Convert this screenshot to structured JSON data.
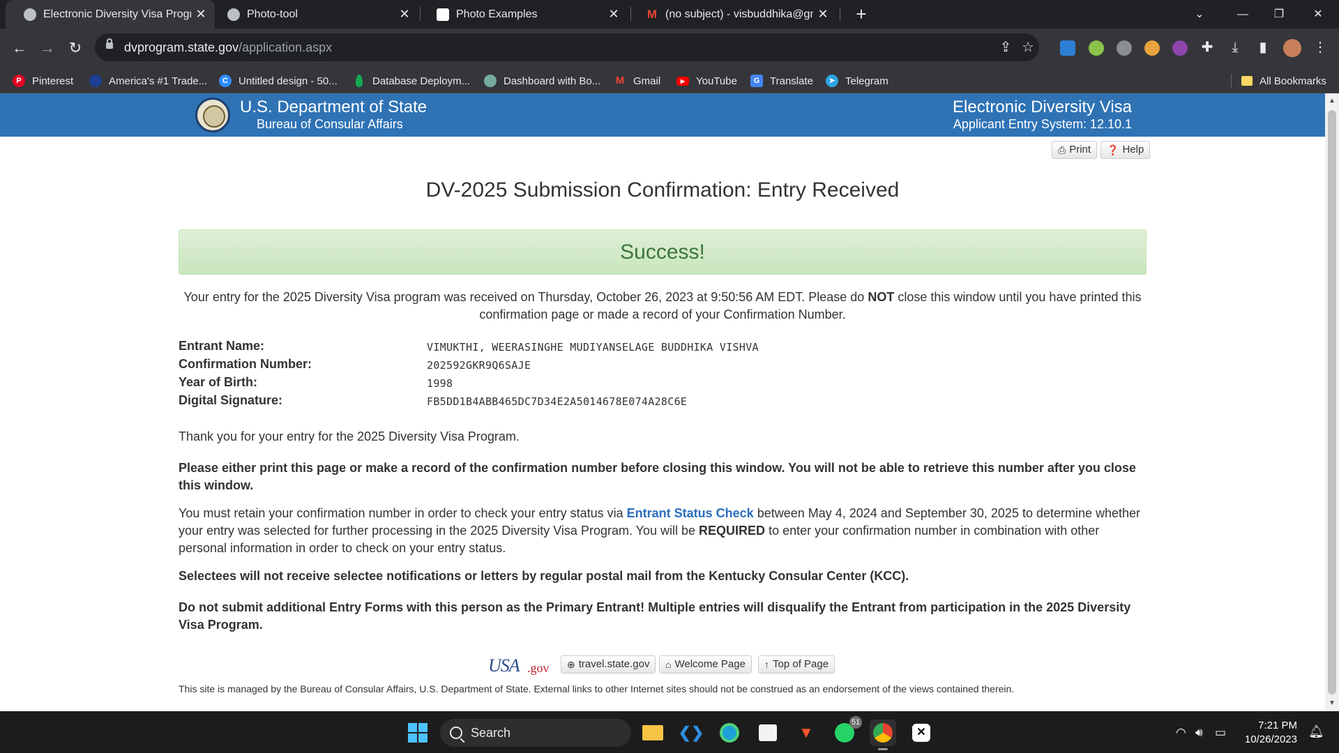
{
  "browser": {
    "tabs": [
      {
        "title": "Electronic Diversity Visa Program",
        "active": true
      },
      {
        "title": "Photo-tool",
        "active": false
      },
      {
        "title": "Photo Examples",
        "active": false
      },
      {
        "title": "(no subject) - visbuddhika@gmail.com",
        "active": false
      }
    ],
    "new_tab_label": "+",
    "url_host": "dvprogram.state.gov",
    "url_path": "/application.aspx",
    "bookmarks": [
      {
        "label": "Pinterest",
        "icon": "pinterest-icon",
        "color": "#e60023"
      },
      {
        "label": "America's #1 Trade...",
        "icon": "trade-icon",
        "color": "#1c3f94"
      },
      {
        "label": "Untitled design - 50...",
        "icon": "canva-icon",
        "color": "#2d8cff"
      },
      {
        "label": "Database Deploym...",
        "icon": "mongodb-icon",
        "color": "#13aa52"
      },
      {
        "label": "Dashboard with Bo...",
        "icon": "chatgpt-icon",
        "color": "#74aa9c"
      },
      {
        "label": "Gmail",
        "icon": "gmail-icon",
        "color": "#ea4335"
      },
      {
        "label": "YouTube",
        "icon": "youtube-icon",
        "color": "#ff0000"
      },
      {
        "label": "Translate",
        "icon": "translate-icon",
        "color": "#4285f4"
      },
      {
        "label": "Telegram",
        "icon": "telegram-icon",
        "color": "#2aa3e0"
      }
    ],
    "all_bookmarks_label": "All Bookmarks"
  },
  "site": {
    "dept": "U.S. Department of State",
    "bureau": "Bureau of Consular Affairs",
    "system_title": "Electronic Diversity Visa",
    "system_version": "Applicant Entry System: 12.10.1",
    "print_label": "Print",
    "help_label": "Help",
    "header_color": "#2f73b5"
  },
  "confirmation": {
    "title": "DV-2025 Submission Confirmation: Entry Received",
    "success": "Success!",
    "received_pre": "Your entry for the 2025 Diversity Visa program was received on Thursday, October 26, 2023 at 9:50:56 AM EDT. Please do ",
    "received_not": "NOT",
    "received_post": " close this window until you have printed this confirmation page or made a record of your Confirmation Number.",
    "details": [
      {
        "label": "Entrant Name:",
        "value": "VIMUKTHI, WEERASINGHE MUDIYANSELAGE BUDDHIKA VISHVA"
      },
      {
        "label": "Confirmation Number:",
        "value": "202592GKR9Q6SAJE"
      },
      {
        "label": "Year of Birth:",
        "value": "1998"
      },
      {
        "label": "Digital Signature:",
        "value": "FB5DD1B4ABB465DC7D34E2A5014678E074A28C6E"
      }
    ],
    "thanks": "Thank you for your entry for the 2025 Diversity Visa Program.",
    "print_warning": "Please either print this page or make a record of the confirmation number before closing this window. You will not be able to retrieve this number after you close this window.",
    "retain_pre": "You must retain your confirmation number in order to check your entry status via ",
    "retain_link": "Entrant Status Check",
    "retain_mid": " between May 4, 2024 and September 30, 2025 to determine whether your entry was selected for further processing in the 2025 Diversity Visa Program. You will be ",
    "retain_required": "REQUIRED",
    "retain_post": " to enter your confirmation number in combination with other personal information in order to check on your entry status.",
    "selectees": "Selectees will not receive selectee notifications or letters by regular postal mail from the Kentucky Consular Center (KCC).",
    "do_not_submit": "Do not submit additional Entry Forms with this person as the Primary Entrant! Multiple entries will disqualify the Entrant from participation in the 2025 Diversity Visa Program."
  },
  "footer": {
    "usagov_usa": "USA",
    "usagov_gov": ".gov",
    "travel_label": "travel.state.gov",
    "welcome_label": "Welcome Page",
    "top_label": "Top of Page",
    "note": "This site is managed by the Bureau of Consular Affairs, U.S. Department of State. External links to other Internet sites should not be construed as an endorsement of the views contained therein."
  },
  "taskbar": {
    "search_label": "Search",
    "whatsapp_badge": "51",
    "time": "7:21 PM",
    "date": "10/26/2023"
  }
}
